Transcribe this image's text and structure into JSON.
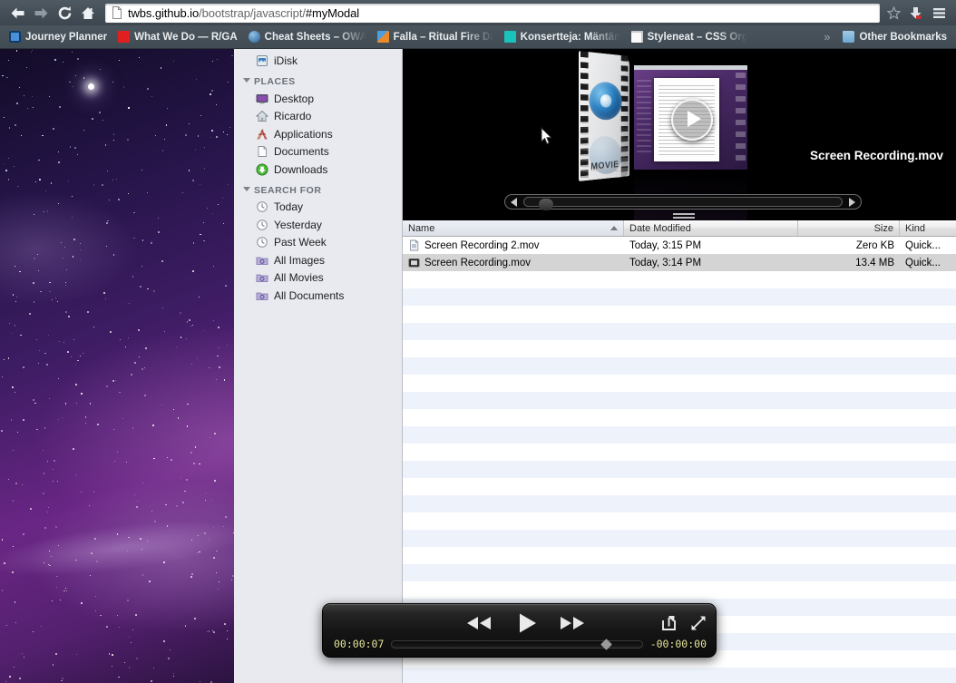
{
  "browser": {
    "nav": {
      "back_icon": "arrow-left-icon",
      "forward_icon": "arrow-right-icon",
      "reload_icon": "reload-icon",
      "home_icon": "home-icon"
    },
    "url": {
      "domain": "twbs.github.io",
      "path": "/bootstrap/javascript/",
      "fragment": "#myModal",
      "page_icon": "page-icon"
    },
    "bookmark_star_icon": "star-icon",
    "download_icon": "download-icon",
    "menu_icon": "hamburger-menu-icon",
    "bookmarks": [
      {
        "label": "Journey Planner",
        "color": "#4a90d9"
      },
      {
        "label": "What We Do — R/GA",
        "color": "#e02020"
      },
      {
        "label": "Cheat Sheets – OWASP",
        "color": "#3b6ea5"
      },
      {
        "label": "Falla – Ritual Fire Dance",
        "color": "#e98a2b"
      },
      {
        "label": "Konsertteja: Mäntän",
        "color": "#19c2bb"
      },
      {
        "label": "Styleneat – CSS Organizer",
        "color": "#f2f2f2"
      }
    ],
    "overflow_label": "»",
    "other_bookmarks": "Other Bookmarks",
    "folder_icon": "folder-icon"
  },
  "finder": {
    "sidebar": {
      "partial_top_item": {
        "label": "",
        "icon": "disk-icon"
      },
      "idisk": {
        "label": "iDisk",
        "icon": "idisk-icon"
      },
      "groups": [
        {
          "title": "PLACES",
          "items": [
            {
              "label": "Desktop",
              "icon": "desktop-icon"
            },
            {
              "label": "Ricardo",
              "icon": "home-folder-icon"
            },
            {
              "label": "Applications",
              "icon": "applications-icon"
            },
            {
              "label": "Documents",
              "icon": "documents-icon"
            },
            {
              "label": "Downloads",
              "icon": "downloads-icon"
            }
          ]
        },
        {
          "title": "SEARCH FOR",
          "items": [
            {
              "label": "Today",
              "icon": "clock-icon"
            },
            {
              "label": "Yesterday",
              "icon": "clock-icon"
            },
            {
              "label": "Past Week",
              "icon": "clock-icon"
            },
            {
              "label": "All Images",
              "icon": "smart-folder-icon"
            },
            {
              "label": "All Movies",
              "icon": "smart-folder-icon"
            },
            {
              "label": "All Documents",
              "icon": "smart-folder-icon"
            }
          ]
        }
      ]
    },
    "coverflow": {
      "caption": "Screen Recording.mov",
      "movie_badge_text": "MOVIE",
      "play_overlay_icon": "play-overlay-icon",
      "left_arrow_icon": "scroll-left-arrow-icon",
      "right_arrow_icon": "scroll-right-arrow-icon",
      "resize_grip_icon": "resize-grip-icon",
      "cursor_icon": "mouse-cursor-icon"
    },
    "filelist": {
      "columns": [
        {
          "key": "name",
          "label": "Name",
          "sorted": true,
          "sort_dir": "asc"
        },
        {
          "key": "date",
          "label": "Date Modified",
          "sorted": false
        },
        {
          "key": "size",
          "label": "Size",
          "sorted": false
        },
        {
          "key": "kind",
          "label": "Kind",
          "sorted": false
        }
      ],
      "rows": [
        {
          "name": "Screen Recording 2.mov",
          "date": "Today, 3:15 PM",
          "size": "Zero KB",
          "kind": "Quick...",
          "icon": "document-icon",
          "selected": false
        },
        {
          "name": "Screen Recording.mov",
          "date": "Today, 3:14 PM",
          "size": "13.4 MB",
          "kind": "Quick...",
          "icon": "movie-file-icon",
          "selected": true
        }
      ],
      "empty_row_count": 24
    }
  },
  "player": {
    "rewind_icon": "rewind-icon",
    "play_icon": "play-icon",
    "fast_forward_icon": "fast-forward-icon",
    "share_icon": "share-icon",
    "fullscreen_icon": "fullscreen-icon",
    "elapsed_time": "00:00:07",
    "remaining_time": "-00:00:00",
    "playhead_position_pct": 84
  }
}
